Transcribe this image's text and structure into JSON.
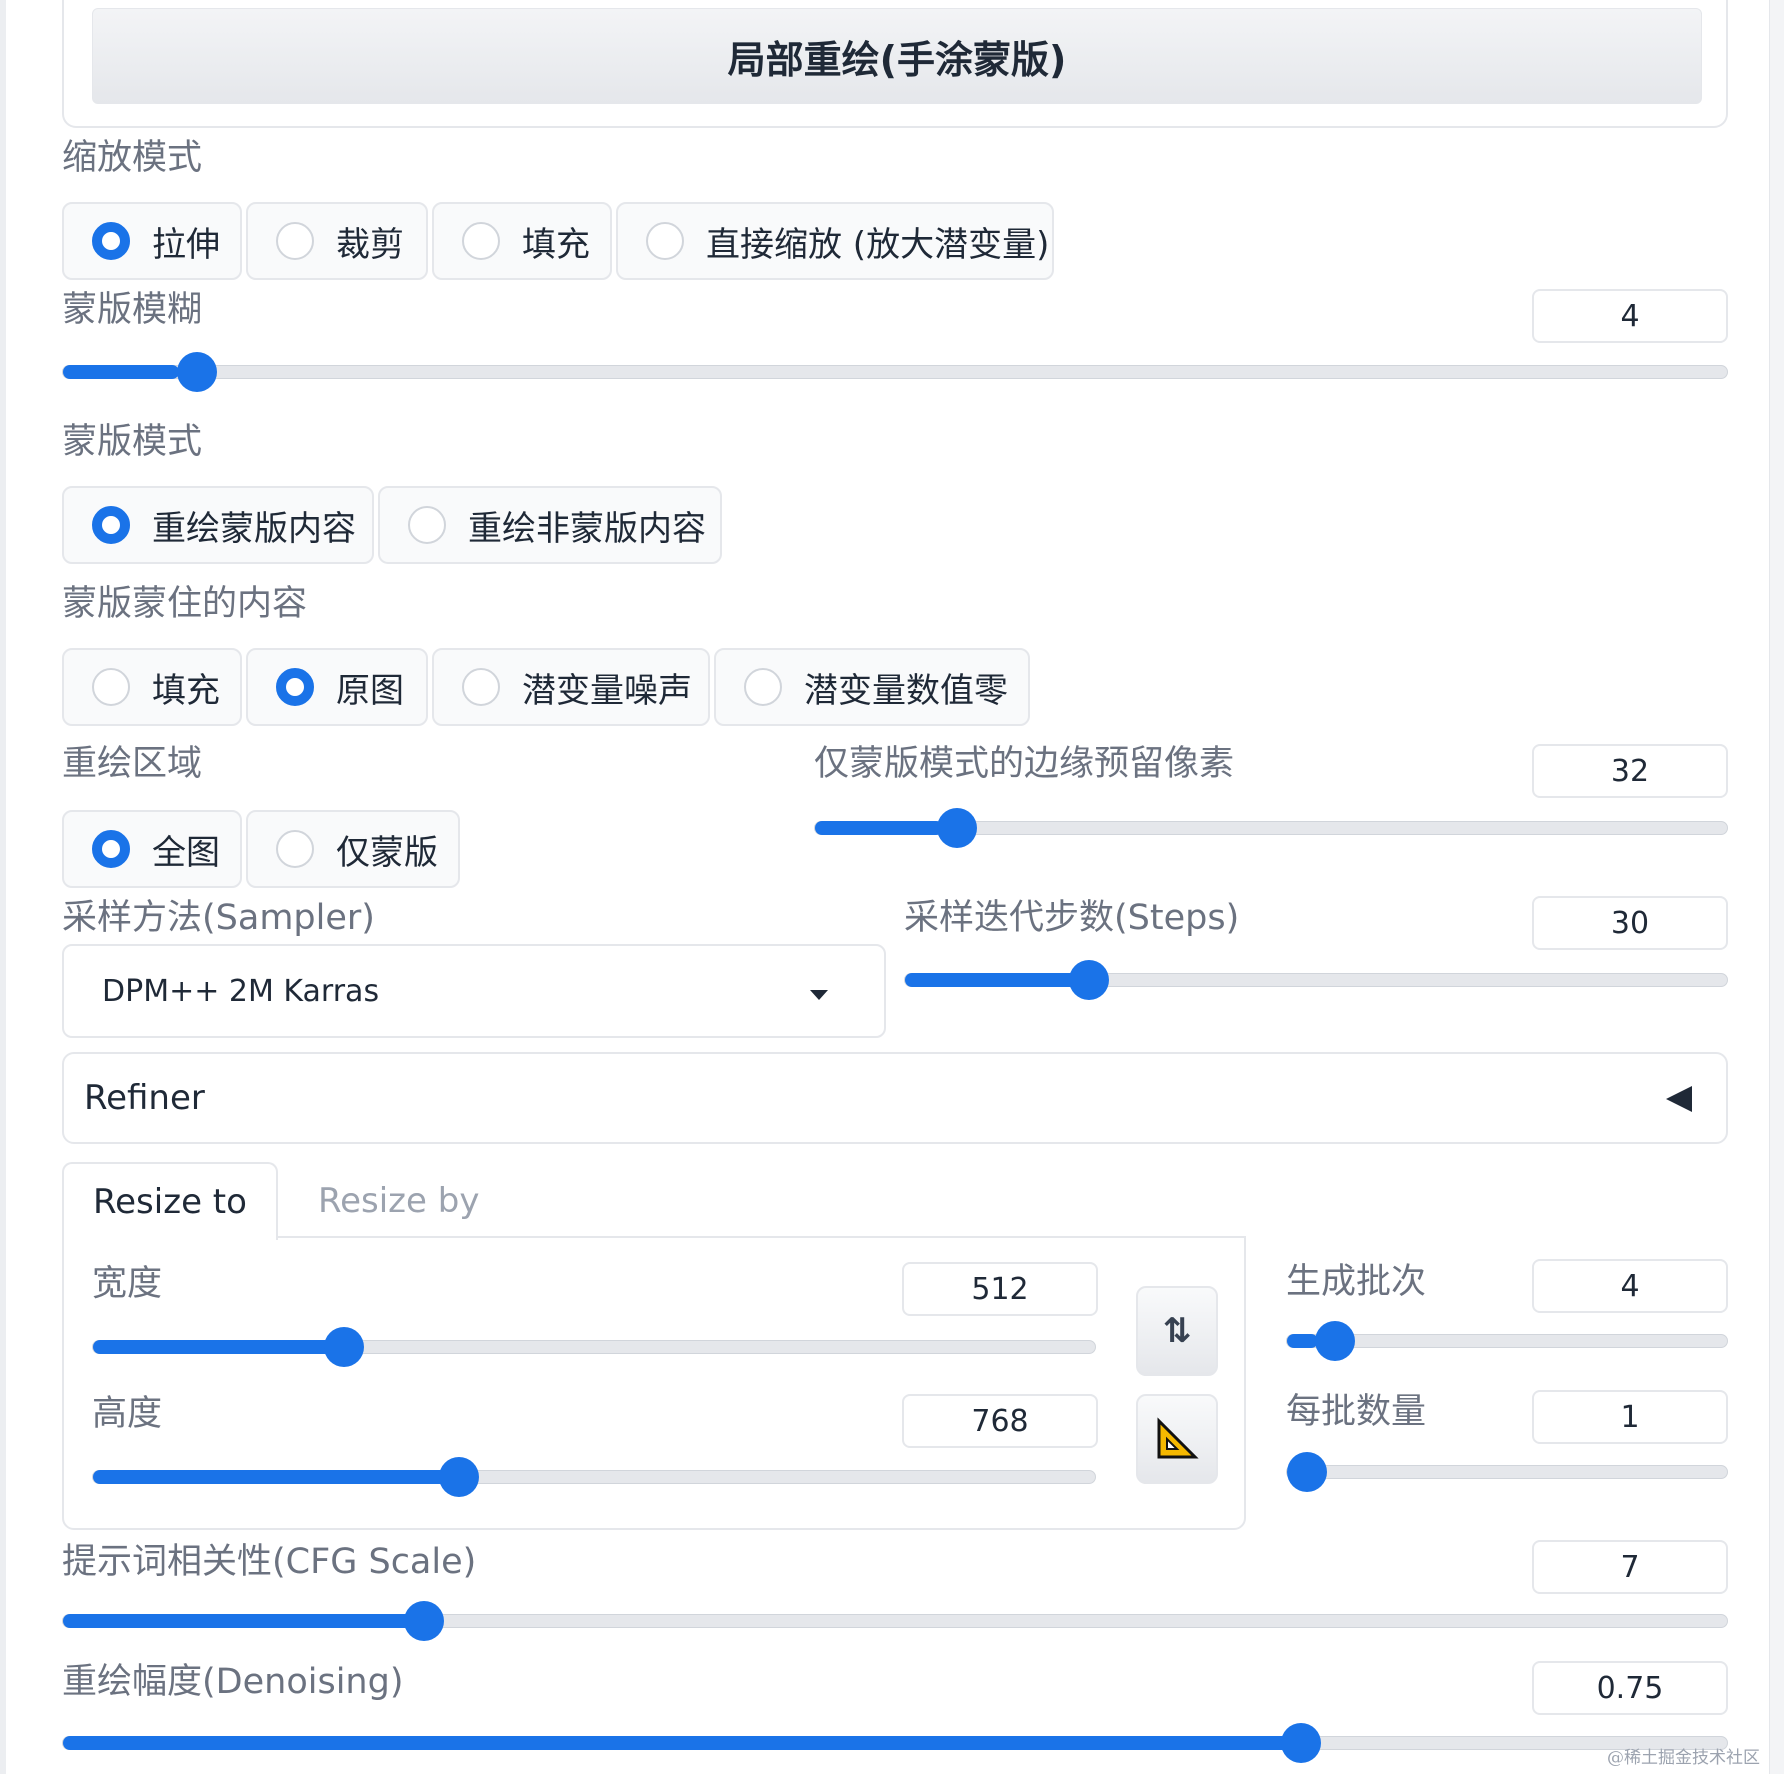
{
  "header": {
    "title": "局部重绘(手涂蒙版)"
  },
  "resize_mode": {
    "label": "缩放模式",
    "options": [
      "拉伸",
      "裁剪",
      "填充",
      "直接缩放 (放大潜变量)"
    ],
    "selected": "拉伸"
  },
  "mask_blur": {
    "label": "蒙版模糊",
    "value": "4",
    "fraction": 0.07
  },
  "mask_mode": {
    "label": "蒙版模式",
    "options": [
      "重绘蒙版内容",
      "重绘非蒙版内容"
    ],
    "selected": "重绘蒙版内容"
  },
  "masked_content": {
    "label": "蒙版蒙住的内容",
    "options": [
      "填充",
      "原图",
      "潜变量噪声",
      "潜变量数值零"
    ],
    "selected": "原图"
  },
  "inpaint_area": {
    "label": "重绘区域",
    "options": [
      "全图",
      "仅蒙版"
    ],
    "selected": "全图"
  },
  "only_masked_padding": {
    "label": "仅蒙版模式的边缘预留像素",
    "value": "32",
    "fraction": 0.14
  },
  "sampler": {
    "label": "采样方法(Sampler)",
    "value": "DPM++ 2M Karras"
  },
  "steps": {
    "label": "采样迭代步数(Steps)",
    "value": "30",
    "fraction": 0.21
  },
  "refiner": {
    "label": "Refiner"
  },
  "tabs": {
    "active": "Resize to",
    "inactive": "Resize by"
  },
  "width": {
    "label": "宽度",
    "value": "512",
    "fraction": 0.24
  },
  "height": {
    "label": "高度",
    "value": "768",
    "fraction": 0.36
  },
  "swap_button": {
    "label": "⇅"
  },
  "batch_count": {
    "label": "生成批次",
    "value": "4",
    "fraction": 0.07
  },
  "batch_size": {
    "label": "每批数量",
    "value": "1",
    "fraction": 0.0
  },
  "cfg_scale": {
    "label": "提示词相关性(CFG Scale)",
    "value": "7",
    "fraction": 0.21
  },
  "denoising": {
    "label": "重绘幅度(Denoising)",
    "value": "0.75",
    "fraction": 0.75
  },
  "watermark": "@稀土掘金技术社区",
  "colors": {
    "accent": "#1a73e8",
    "border": "#e5e7eb",
    "label": "#6b7280"
  },
  "icons": {
    "swap": "swap-vertical-icon",
    "ratio": "triangle-ruler-icon",
    "refiner": "collapse-triangle-icon",
    "dropdown": "chevron-down-icon"
  }
}
